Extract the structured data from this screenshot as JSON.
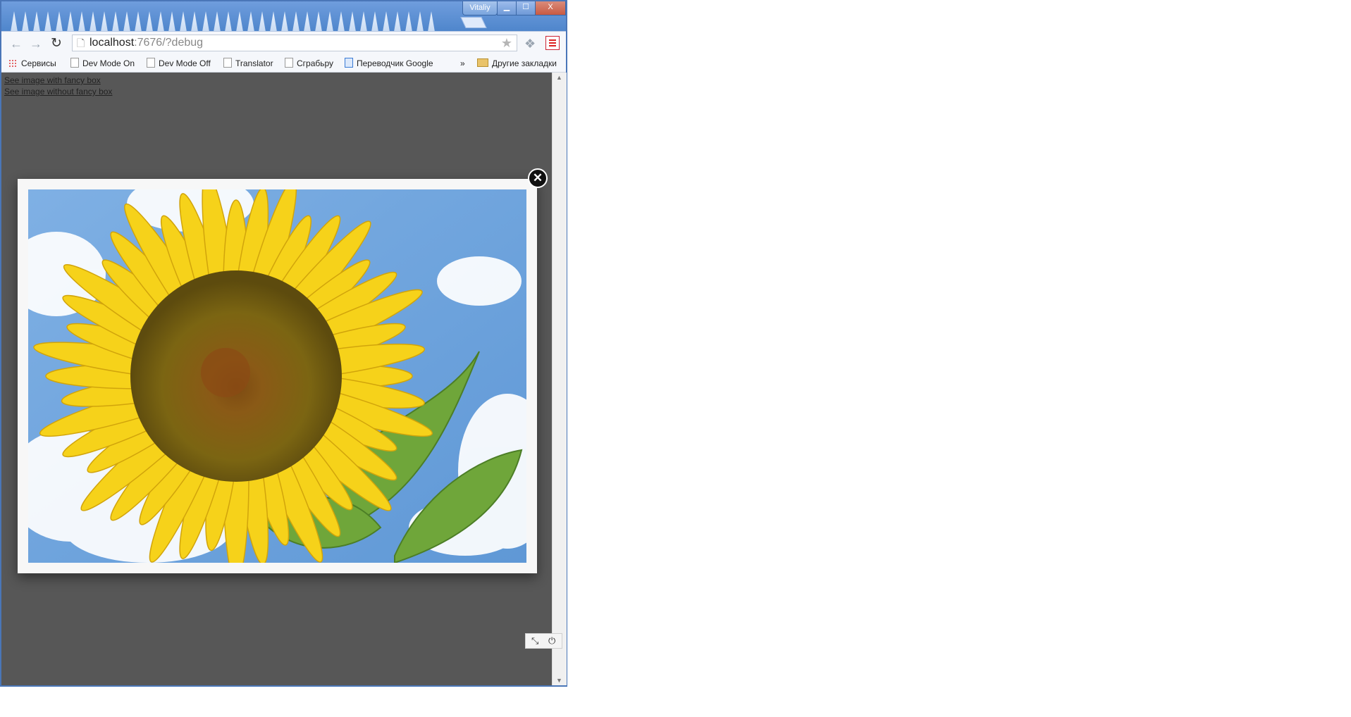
{
  "browser": {
    "profile_name": "Vitaliy",
    "window_controls": {
      "minimize": "▁",
      "maximize": "☐",
      "close": "X"
    },
    "url_host": "localhost",
    "url_path": ":7676/?debug"
  },
  "bookmarks": [
    {
      "label": "Сервисы",
      "icon": "apps-icon"
    },
    {
      "label": "Dev Mode On",
      "icon": "page-icon"
    },
    {
      "label": "Dev Mode Off",
      "icon": "page-icon"
    },
    {
      "label": "Translator",
      "icon": "page-icon"
    },
    {
      "label": "Сграбьру",
      "icon": "page-icon"
    },
    {
      "label": "Переводчик Google",
      "icon": "translate-icon"
    }
  ],
  "bookmarks_overflow": "»",
  "other_bookmarks": "Другие закладки",
  "page": {
    "links": [
      "See image with fancy box",
      "See image without fancy box"
    ]
  },
  "modal": {
    "close_label": "✕",
    "image_subject": "sunflower photo"
  },
  "debug_toolbar": {
    "collapse_icon": "⤡",
    "power_icon": "⏻"
  },
  "colors": {
    "overlay": "#575757",
    "chrome_blue": "#4f86cc",
    "modal_frame": "#f7f7f7"
  }
}
